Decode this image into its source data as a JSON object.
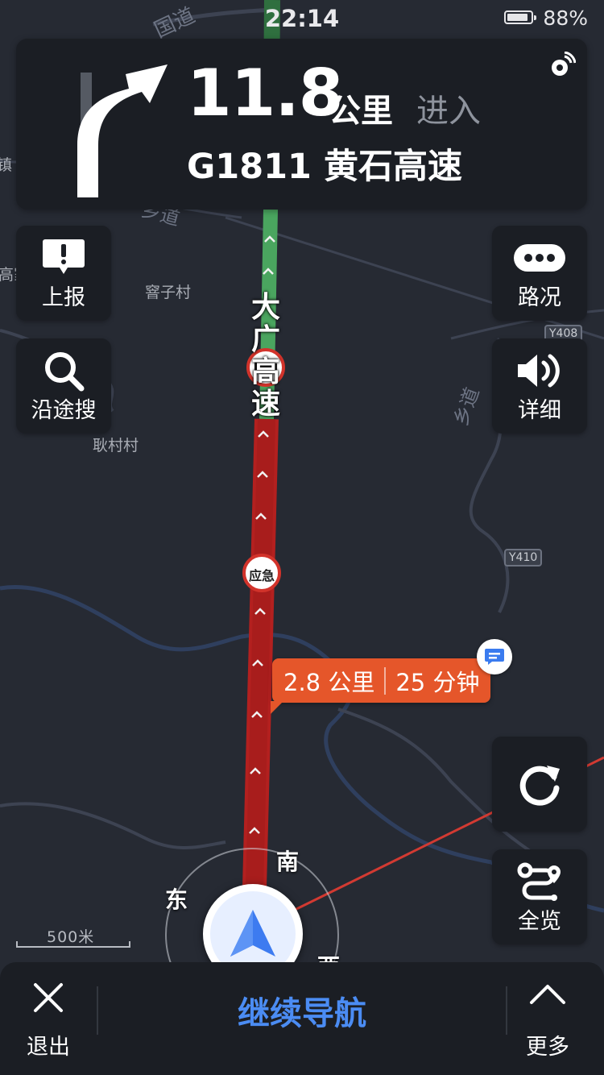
{
  "status_bar": {
    "time": "22:14",
    "battery_percent": "88%",
    "battery_level": 0.88
  },
  "guidance": {
    "distance_value": "11.8",
    "distance_unit": "公里",
    "action": "进入",
    "road_name": "G1811 黄石高速",
    "turn_icon": "bear-right-arrow-icon",
    "gps_icon": "gps-signal-icon"
  },
  "left_buttons": [
    {
      "label": "上报",
      "icon": "report-alert-icon"
    },
    {
      "label": "沿途搜",
      "icon": "search-icon"
    }
  ],
  "right_buttons": [
    {
      "label": "路况",
      "icon": "traffic-dots-icon"
    },
    {
      "label": "详细",
      "icon": "speaker-icon"
    },
    {
      "label": "",
      "icon": "refresh-icon"
    },
    {
      "label": "全览",
      "icon": "route-overview-icon"
    }
  ],
  "map": {
    "places": [
      "窨子村",
      "耿村村",
      "高家",
      "镇"
    ],
    "road_badges": [
      "Y408",
      "Y410"
    ],
    "road_labels": [
      "国道",
      "乡道",
      "乡道",
      "大广高速"
    ],
    "route_markers": [
      "应急"
    ],
    "scale_label": "500米",
    "colors": {
      "route_congested": "#b3201f",
      "route_clear": "#3e9f55",
      "callout": "#e5562a",
      "accent": "#4b8cf3"
    }
  },
  "route_callout": {
    "distance": "2.8 公里",
    "time": "25 分钟"
  },
  "compass": {
    "east": "东",
    "south": "南",
    "west": "西"
  },
  "bottom_bar": {
    "exit": "退出",
    "continue": "继续导航",
    "more": "更多"
  }
}
